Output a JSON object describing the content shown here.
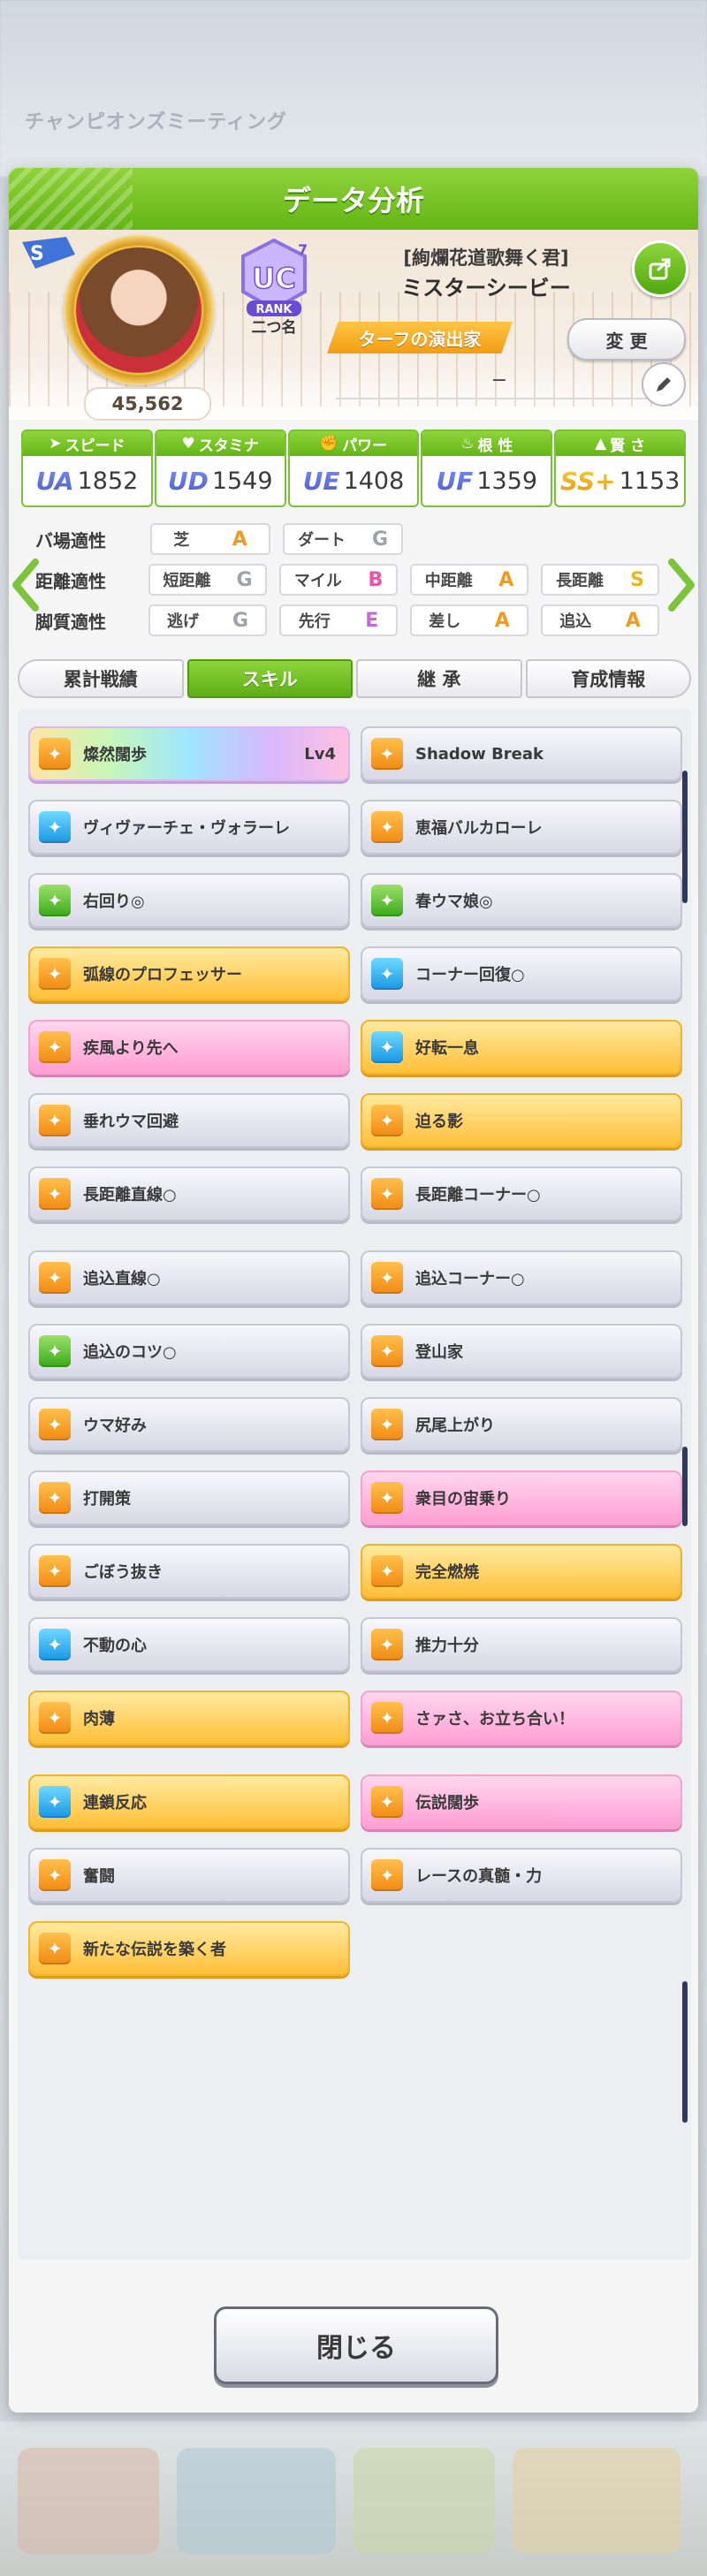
{
  "background": {
    "blurred_title": "チャンピオンズミーティング"
  },
  "dialog": {
    "title": "データ分析"
  },
  "profile": {
    "fans": "45,562",
    "rank_badge": "UC",
    "rank_sub": "7",
    "rank_word": "RANK",
    "nickname": "二つ名",
    "epithet": "[絢爛花道歌舞く君]",
    "name": "ミスターシービー",
    "title_ribbon": "ターフの演出家",
    "change_label": "変 更",
    "subtitle": "−"
  },
  "stats": [
    {
      "label": "スピード",
      "grade": "UA",
      "value": "1852"
    },
    {
      "label": "スタミナ",
      "grade": "UD",
      "value": "1549"
    },
    {
      "label": "パワー",
      "grade": "UE",
      "value": "1408"
    },
    {
      "label": "根 性",
      "grade": "UF",
      "value": "1359"
    },
    {
      "label": "賢 さ",
      "grade": "SS+",
      "value": "1153"
    }
  ],
  "aptitude": {
    "track": {
      "label": "バ場適性",
      "items": [
        {
          "name": "芝",
          "grade": "A"
        },
        {
          "name": "ダート",
          "grade": "G"
        }
      ]
    },
    "distance": {
      "label": "距離適性",
      "items": [
        {
          "name": "短距離",
          "grade": "G"
        },
        {
          "name": "マイル",
          "grade": "B"
        },
        {
          "name": "中距離",
          "grade": "A"
        },
        {
          "name": "長距離",
          "grade": "S"
        }
      ]
    },
    "style": {
      "label": "脚質適性",
      "items": [
        {
          "name": "逃げ",
          "grade": "G"
        },
        {
          "name": "先行",
          "grade": "E"
        },
        {
          "name": "差し",
          "grade": "A"
        },
        {
          "name": "追込",
          "grade": "A"
        }
      ]
    }
  },
  "tabs": [
    "累計戦績",
    "スキル",
    "継 承",
    "育成情報"
  ],
  "active_tab": "スキル",
  "skills": [
    {
      "name": "燦然闊歩",
      "level": "Lv4",
      "style": "rainbow",
      "icon": "orange"
    },
    {
      "name": "Shadow Break",
      "level": "",
      "style": "silver",
      "icon": "orange"
    },
    {
      "name": "ヴィヴァーチェ・ヴォラーレ",
      "level": "",
      "style": "silver",
      "icon": "blue"
    },
    {
      "name": "恵福バルカローレ",
      "level": "",
      "style": "silver",
      "icon": "orange"
    },
    {
      "name": "右回り◎",
      "level": "",
      "style": "silver",
      "icon": "green"
    },
    {
      "name": "春ウマ娘◎",
      "level": "",
      "style": "silver",
      "icon": "green"
    },
    {
      "name": "弧線のプロフェッサー",
      "level": "",
      "style": "gold",
      "icon": "orange"
    },
    {
      "name": "コーナー回復○",
      "level": "",
      "style": "silver",
      "icon": "blue"
    },
    {
      "name": "疾風より先へ",
      "level": "",
      "style": "pink",
      "icon": "orange"
    },
    {
      "name": "好転一息",
      "level": "",
      "style": "gold",
      "icon": "blue"
    },
    {
      "name": "垂れウマ回避",
      "level": "",
      "style": "silver",
      "icon": "orange"
    },
    {
      "name": "迫る影",
      "level": "",
      "style": "gold",
      "icon": "orange"
    },
    {
      "name": "長距離直線○",
      "level": "",
      "style": "silver",
      "icon": "orange"
    },
    {
      "name": "長距離コーナー○",
      "level": "",
      "style": "silver",
      "icon": "orange"
    },
    {
      "name": "追込直線○",
      "level": "",
      "style": "silver",
      "icon": "orange"
    },
    {
      "name": "追込コーナー○",
      "level": "",
      "style": "silver",
      "icon": "orange"
    },
    {
      "name": "追込のコツ○",
      "level": "",
      "style": "silver",
      "icon": "green"
    },
    {
      "name": "登山家",
      "level": "",
      "style": "silver",
      "icon": "orange"
    },
    {
      "name": "ウマ好み",
      "level": "",
      "style": "silver",
      "icon": "orange"
    },
    {
      "name": "尻尾上がり",
      "level": "",
      "style": "silver",
      "icon": "orange"
    },
    {
      "name": "打開策",
      "level": "",
      "style": "silver",
      "icon": "orange"
    },
    {
      "name": "衆目の宙乗り",
      "level": "",
      "style": "pink",
      "icon": "orange"
    },
    {
      "name": "ごぼう抜き",
      "level": "",
      "style": "silver",
      "icon": "orange"
    },
    {
      "name": "完全燃焼",
      "level": "",
      "style": "gold",
      "icon": "orange"
    },
    {
      "name": "不動の心",
      "level": "",
      "style": "silver",
      "icon": "blue"
    },
    {
      "name": "推力十分",
      "level": "",
      "style": "silver",
      "icon": "orange"
    },
    {
      "name": "肉薄",
      "level": "",
      "style": "gold",
      "icon": "orange"
    },
    {
      "name": "さァさ、お立ち合い！",
      "level": "",
      "style": "pink",
      "icon": "orange"
    },
    {
      "name": "連鎖反応",
      "level": "",
      "style": "gold",
      "icon": "blue"
    },
    {
      "name": "伝説闊歩",
      "level": "",
      "style": "pink",
      "icon": "orange"
    },
    {
      "name": "奮闘",
      "level": "",
      "style": "silver",
      "icon": "orange"
    },
    {
      "name": "レースの真髄・力",
      "level": "",
      "style": "silver",
      "icon": "orange"
    },
    {
      "name": "新たな伝説を築く者",
      "level": "",
      "style": "gold",
      "icon": "orange"
    }
  ],
  "close_label": "閉じる"
}
